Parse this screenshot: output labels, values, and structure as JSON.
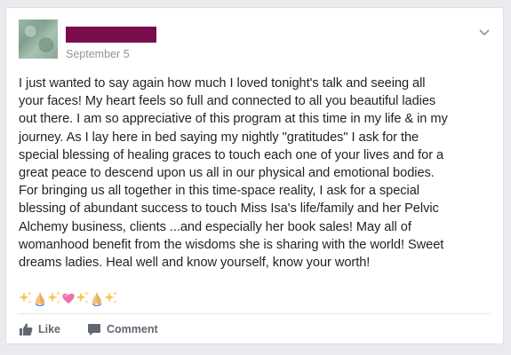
{
  "post": {
    "date": "September 5",
    "text": "I just wanted to say again how much I loved tonight's talk and seeing all\nyour faces! My heart feels so full and connected to all you beautiful ladies\nout there. I am so appreciative of this program at this time in my life & in my\njourney. As I lay here in bed saying my nightly \"gratitudes\" I ask for the\nspecial blessing of healing graces to touch each one of your lives and for a\ngreat peace to descend upon us all in our physical and emotional bodies.\nFor bringing us all together in this time-space reality, I ask for a special\nblessing of abundant success to touch Miss Isa's life/family and her Pelvic\nAlchemy business, clients ...and especially her book sales! May all of\nwomanhood benefit from the wisdoms she is sharing with the world! Sweet\ndreams ladies. Heal well and know yourself, know your worth!",
    "emojis": [
      "sparkles-icon",
      "praying-hands-icon",
      "sparkles-icon",
      "pink-heart-icon",
      "sparkles-icon",
      "praying-hands-icon",
      "sparkles-icon"
    ],
    "redaction_color": "#7a0d4d"
  },
  "actions": {
    "like_label": "Like",
    "comment_label": "Comment"
  },
  "colors": {
    "text": "#1d2129",
    "meta": "#90949c",
    "action": "#606770"
  }
}
